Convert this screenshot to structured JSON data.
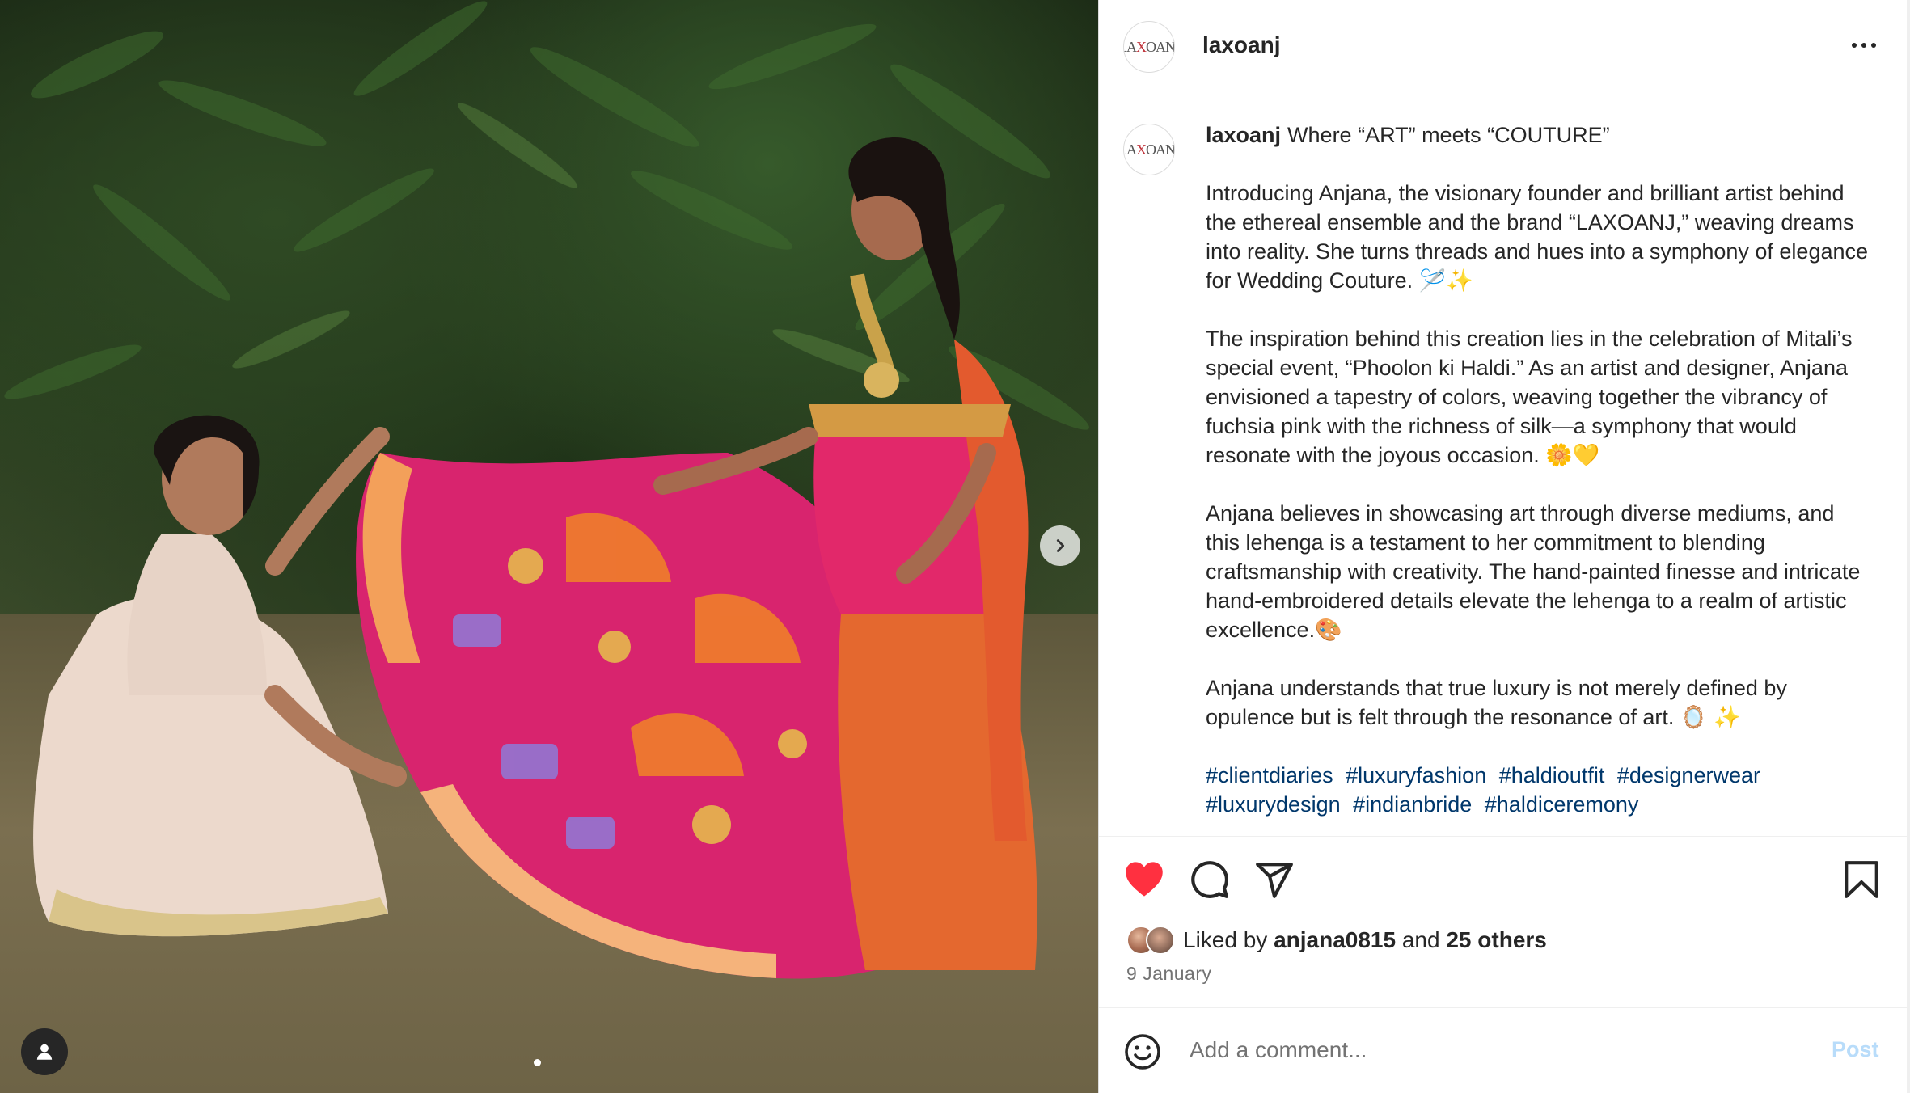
{
  "post": {
    "username": "laxoanj",
    "avatar_logo": "LAXOANJ",
    "more_icon": "more-horizontal-icon"
  },
  "caption": {
    "username": "laxoanj",
    "line1": "Where “ART” meets “COUTURE”",
    "para1": "Introducing Anjana, the visionary founder and brilliant artist behind the ethereal ensemble and the brand “LAXOANJ,” weaving dreams into reality. She turns threads and hues into a symphony of elegance for Wedding Couture. 🪡✨",
    "para2": "The inspiration behind this creation lies in the celebration of Mitali’s special event, “Phoolon ki Haldi.” As an artist and designer, Anjana envisioned a tapestry of colors, weaving together the vibrancy of fuchsia pink with the richness of silk—a symphony that would resonate with the joyous occasion. 🌼💛",
    "para3": "Anjana believes in showcasing art through diverse mediums, and this lehenga is a testament to her commitment to blending craftsmanship with creativity. The hand-painted finesse and intricate hand-embroidered details elevate the lehenga to a realm of artistic excellence.🎨",
    "para4": "Anjana understands that true luxury is not merely defined by opulence but is felt through the resonance of art. 🪞 ✨",
    "hashtags": [
      "#clientdiaries",
      "#luxuryfashion",
      "#haldioutfit",
      "#designerwear",
      "#luxurydesign",
      "#indianbride",
      "#haldiceremony"
    ]
  },
  "actions": {
    "like_icon": "heart-filled-icon",
    "comment_icon": "comment-icon",
    "share_icon": "send-icon",
    "save_icon": "bookmark-icon",
    "liked_prefix": "Liked by",
    "liked_user": "anjana0815",
    "liked_and": "and",
    "liked_others": "25 others",
    "date": "9 January",
    "like_color": "#ff3040"
  },
  "comment": {
    "placeholder": "Add a comment...",
    "post_label": "Post",
    "post_color": "#b8dcfa"
  },
  "carousel": {
    "next_icon": "chevron-right-icon",
    "tag_icon": "user-tag-icon",
    "dots": 1
  }
}
